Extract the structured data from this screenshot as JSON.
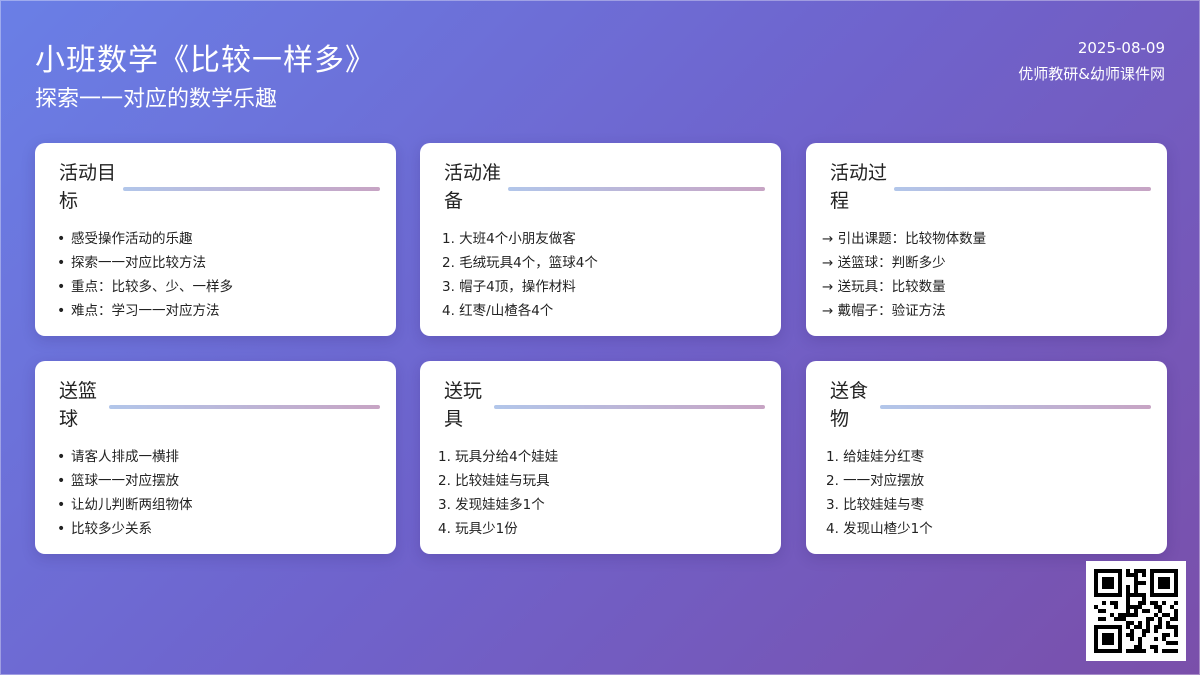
{
  "header": {
    "title": "小班数学《比较一样多》",
    "subtitle": "探索一一对应的数学乐趣",
    "date": "2025-08-09",
    "source": "优师教研&幼师课件网"
  },
  "cards": [
    {
      "title": "活动目标",
      "style": "bullet",
      "items": [
        "感受操作活动的乐趣",
        "探索一一对应比较方法",
        "重点：比较多、少、一样多",
        "难点：学习一一对应方法"
      ]
    },
    {
      "title": "活动准备",
      "style": "numbered",
      "items": [
        "1. 大班4个小朋友做客",
        "2. 毛绒玩具4个，篮球4个",
        "3. 帽子4顶，操作材料",
        "4. 红枣/山楂各4个"
      ]
    },
    {
      "title": "活动过程",
      "style": "arrow",
      "items": [
        "→ 引出课题：比较物体数量",
        "→ 送篮球：判断多少",
        "→ 送玩具：比较数量",
        "→ 戴帽子：验证方法"
      ]
    },
    {
      "title": "送篮球",
      "style": "bullet",
      "items": [
        "请客人排成一横排",
        "篮球一一对应摆放",
        "让幼儿判断两组物体",
        "比较多少关系"
      ]
    },
    {
      "title": "送玩具",
      "style": "numbered",
      "items": [
        "1. 玩具分给4个娃娃",
        "2. 比较娃娃与玩具",
        "3. 发现娃娃多1个",
        "4. 玩具少1份"
      ]
    },
    {
      "title": "送食物",
      "style": "numbered",
      "items": [
        "1. 给娃娃分红枣",
        "2. 一一对应摆放",
        "3. 比较娃娃与枣",
        "4. 发现山楂少1个"
      ]
    }
  ],
  "qr": {
    "icon": "qr-code-icon"
  },
  "colors": {
    "bg_start": "#6a7fe6",
    "bg_end": "#7a4faa",
    "accent_line_start": "#b2c6ea",
    "accent_line_end": "#c7a4c4"
  }
}
